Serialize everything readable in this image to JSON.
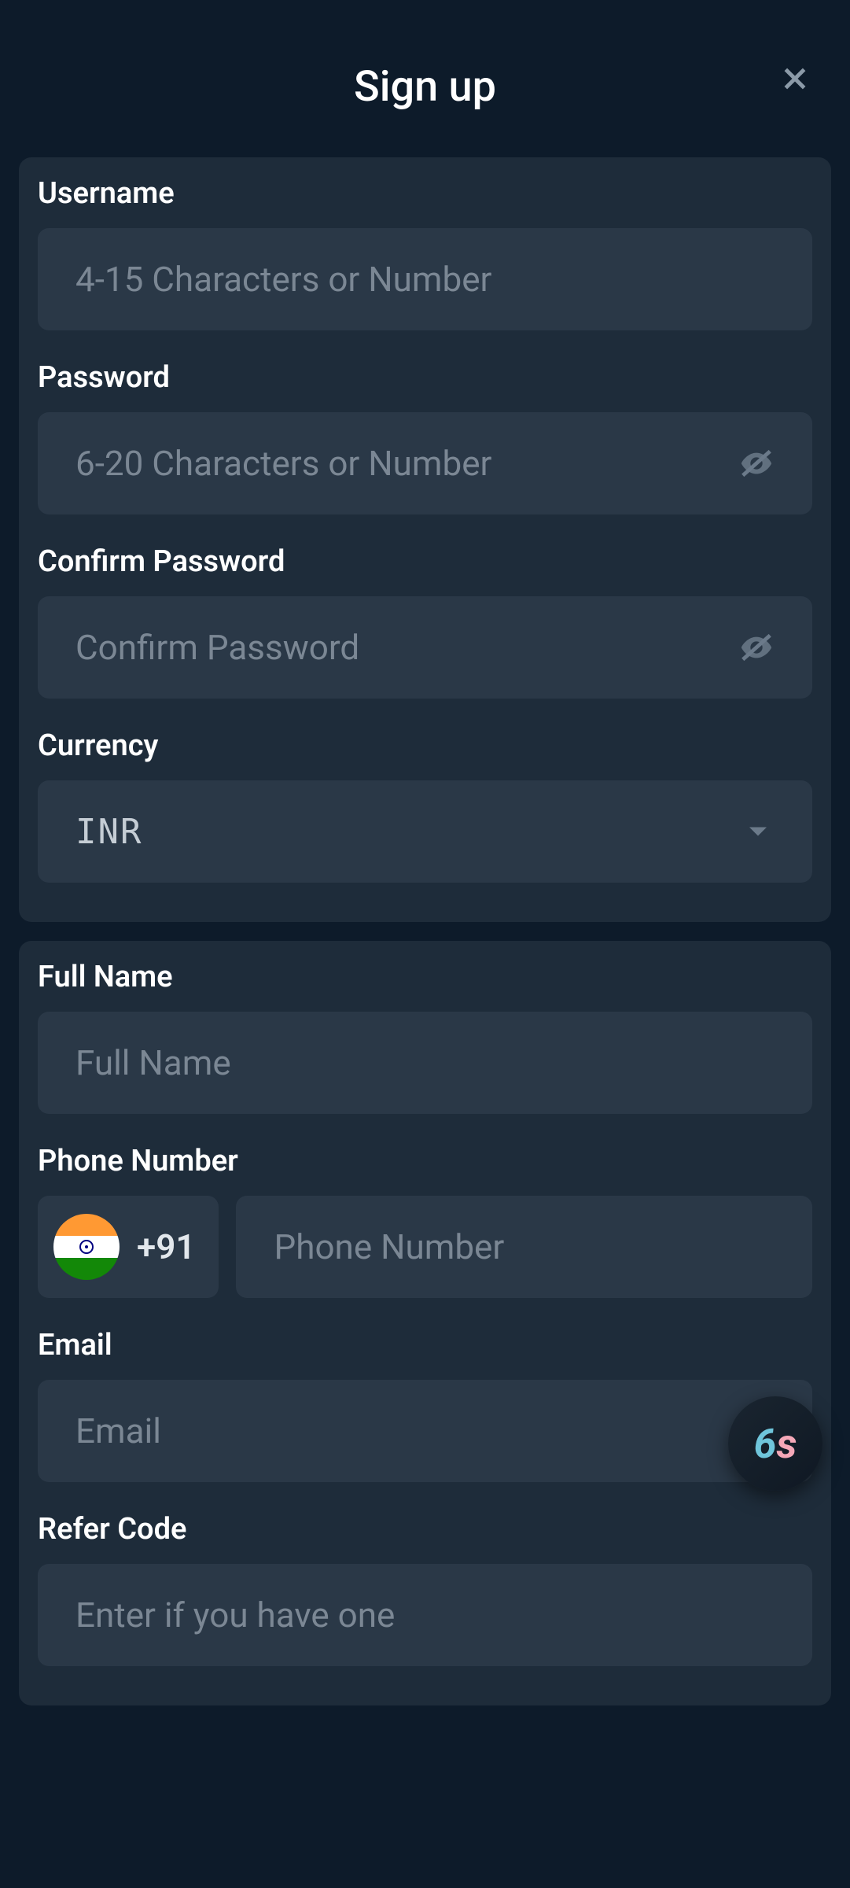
{
  "header": {
    "title": "Sign up",
    "close_icon": "close-icon"
  },
  "form": {
    "username": {
      "label": "Username",
      "placeholder": "4-15 Characters or Number",
      "value": ""
    },
    "password": {
      "label": "Password",
      "placeholder": "6-20 Characters or Number",
      "value": ""
    },
    "confirm_password": {
      "label": "Confirm Password",
      "placeholder": "Confirm Password",
      "value": ""
    },
    "currency": {
      "label": "Currency",
      "selected": "INR"
    },
    "full_name": {
      "label": "Full Name",
      "placeholder": "Full Name",
      "value": ""
    },
    "phone": {
      "label": "Phone Number",
      "country_code": "+91",
      "country": "India",
      "placeholder": "Phone Number",
      "value": ""
    },
    "email": {
      "label": "Email",
      "placeholder": "Email",
      "value": ""
    },
    "refer_code": {
      "label": "Refer Code",
      "placeholder": "Enter if you have one",
      "value": ""
    }
  },
  "fab": {
    "part1": "6",
    "part2": "s"
  }
}
